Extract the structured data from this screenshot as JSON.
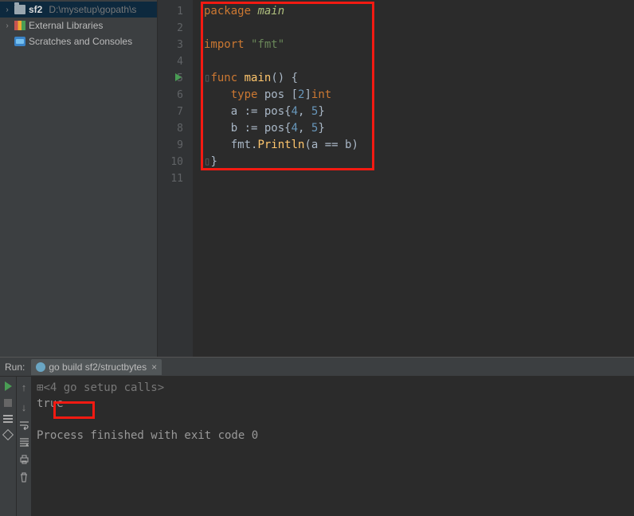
{
  "sidebar": {
    "project": {
      "name": "sf2",
      "path": "D:\\mysetup\\gopath\\s"
    },
    "libraries": "External Libraries",
    "scratches": "Scratches and Consoles"
  },
  "editor": {
    "line_count": 11,
    "run_marker_line": 5,
    "code": {
      "l1": {
        "kw": "package",
        "pkg": " main"
      },
      "l3": {
        "kw": "import",
        "str": " \"fmt\""
      },
      "l5": {
        "kw": "func",
        "fn": " main",
        "rest": "() {"
      },
      "l6": {
        "indent": "    ",
        "kw": "type",
        "typ": " pos ",
        "arr": "[",
        "num": "2",
        "arr2": "]",
        "t2": "int"
      },
      "l7": {
        "indent": "    ",
        "var": "a := pos{",
        "n1": "4",
        "c": ", ",
        "n2": "5",
        "end": "}"
      },
      "l8": {
        "indent": "    ",
        "var": "b := pos{",
        "n1": "4",
        "c": ", ",
        "n2": "5",
        "end": "}"
      },
      "l9": {
        "indent": "    ",
        "obj": "fmt.",
        "fn": "Println",
        "rest": "(a == b)"
      },
      "l10": "}"
    }
  },
  "run": {
    "label": "Run:",
    "tab": "go build sf2/structbytes",
    "console": {
      "fold": "<4 go setup calls>",
      "out": "true",
      "exit": "Process finished with exit code 0"
    }
  }
}
